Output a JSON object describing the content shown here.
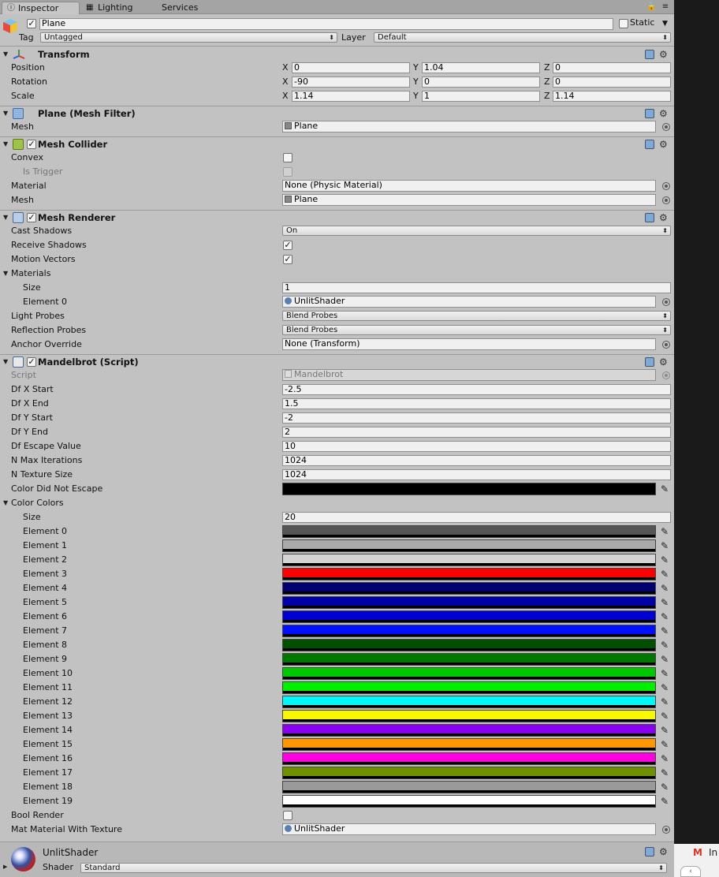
{
  "tabs": [
    "Inspector",
    "Lighting",
    "Services"
  ],
  "object": {
    "name": "Plane",
    "static_label": "Static",
    "tag_label": "Tag",
    "tag_value": "Untagged",
    "layer_label": "Layer",
    "layer_value": "Default"
  },
  "transform": {
    "title": "Transform",
    "rows": [
      {
        "label": "Position",
        "x": "0",
        "y": "1.04",
        "z": "0"
      },
      {
        "label": "Rotation",
        "x": "-90",
        "y": "0",
        "z": "0"
      },
      {
        "label": "Scale",
        "x": "1.14",
        "y": "1",
        "z": "1.14"
      }
    ],
    "axes": [
      "X",
      "Y",
      "Z"
    ]
  },
  "mesh_filter": {
    "title": "Plane (Mesh Filter)",
    "mesh_label": "Mesh",
    "mesh_value": "Plane"
  },
  "mesh_collider": {
    "title": "Mesh Collider",
    "convex_label": "Convex",
    "convex_checked": false,
    "trigger_label": "Is Trigger",
    "material_label": "Material",
    "material_value": "None (Physic Material)",
    "mesh_label": "Mesh",
    "mesh_value": "Plane"
  },
  "mesh_renderer": {
    "title": "Mesh Renderer",
    "cast_label": "Cast Shadows",
    "cast_value": "On",
    "receive_label": "Receive Shadows",
    "receive_checked": true,
    "motion_label": "Motion Vectors",
    "motion_checked": true,
    "materials_label": "Materials",
    "size_label": "Size",
    "size_value": "1",
    "element_label": "Element 0",
    "element_value": "UnlitShader",
    "light_label": "Light Probes",
    "light_value": "Blend Probes",
    "reflection_label": "Reflection Probes",
    "reflection_value": "Blend Probes",
    "anchor_label": "Anchor Override",
    "anchor_value": "None (Transform)"
  },
  "script": {
    "title": "Mandelbrot (Script)",
    "script_label": "Script",
    "script_value": "Mandelbrot",
    "fields": [
      {
        "label": "Df X Start",
        "value": "-2.5"
      },
      {
        "label": "Df X End",
        "value": "1.5"
      },
      {
        "label": "Df Y Start",
        "value": "-2"
      },
      {
        "label": "Df Y End",
        "value": "2"
      },
      {
        "label": "Df Escape Value",
        "value": "10"
      },
      {
        "label": "N Max Iterations",
        "value": "1024"
      },
      {
        "label": "N Texture Size",
        "value": "1024"
      }
    ],
    "color_not_escape_label": "Color Did Not Escape",
    "color_not_escape": "#000000",
    "colors_label": "Color Colors",
    "colors_size_label": "Size",
    "colors_size_value": "20",
    "colors": [
      {
        "label": "Element 0",
        "color": "#555555"
      },
      {
        "label": "Element 1",
        "color": "#aaaaaa"
      },
      {
        "label": "Element 2",
        "color": "#d4d4d4"
      },
      {
        "label": "Element 3",
        "color": "#ff0000"
      },
      {
        "label": "Element 4",
        "color": "#000070"
      },
      {
        "label": "Element 5",
        "color": "#0000a8"
      },
      {
        "label": "Element 6",
        "color": "#0000d0"
      },
      {
        "label": "Element 7",
        "color": "#0010ff"
      },
      {
        "label": "Element 8",
        "color": "#005000"
      },
      {
        "label": "Element 9",
        "color": "#007800"
      },
      {
        "label": "Element 10",
        "color": "#00c800"
      },
      {
        "label": "Element 11",
        "color": "#00f000"
      },
      {
        "label": "Element 12",
        "color": "#00f8f8"
      },
      {
        "label": "Element 13",
        "color": "#f8f800"
      },
      {
        "label": "Element 14",
        "color": "#8a00f0"
      },
      {
        "label": "Element 15",
        "color": "#ff9800"
      },
      {
        "label": "Element 16",
        "color": "#ff00e0"
      },
      {
        "label": "Element 17",
        "color": "#709000"
      },
      {
        "label": "Element 18",
        "color": "#9a9a9a"
      },
      {
        "label": "Element 19",
        "color": "#ffffff"
      }
    ],
    "bool_render_label": "Bool Render",
    "mat_label": "Mat Material With Texture",
    "mat_value": "UnlitShader"
  },
  "material": {
    "name": "UnlitShader",
    "shader_label": "Shader",
    "shader_value": "Standard"
  },
  "taskbar": {
    "text": "In"
  }
}
